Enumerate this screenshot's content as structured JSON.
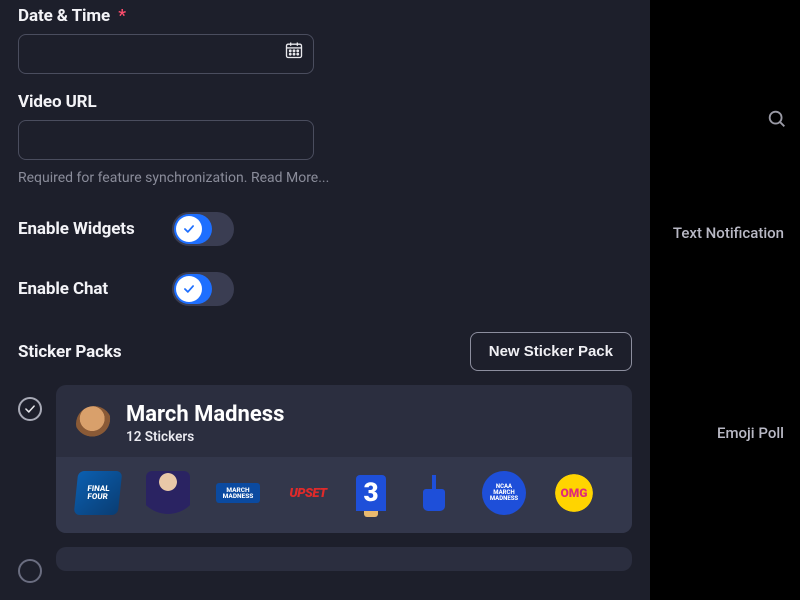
{
  "fields": {
    "datetime": {
      "label": "Date & Time",
      "required_mark": "*",
      "value": ""
    },
    "video_url": {
      "label": "Video URL",
      "value": "",
      "helper": "Required for feature synchronization.",
      "helper_link": "Read More..."
    }
  },
  "toggles": {
    "widgets": {
      "label": "Enable Widgets",
      "on": true
    },
    "chat": {
      "label": "Enable Chat",
      "on": true
    }
  },
  "sticker_section": {
    "label": "Sticker Packs",
    "new_button": "New Sticker Pack",
    "packs": [
      {
        "selected": true,
        "name": "March Madness",
        "count_label": "12 Stickers",
        "stickers": [
          {
            "name": "final-four",
            "text": "FINAL\nFOUR"
          },
          {
            "name": "player-yell",
            "text": ""
          },
          {
            "name": "march-madness-logo",
            "text": "MARCH\nMADNESS"
          },
          {
            "name": "upset",
            "text": "UPSET"
          },
          {
            "name": "foam-three",
            "text": "3"
          },
          {
            "name": "foam-finger",
            "text": ""
          },
          {
            "name": "ncaa-badge",
            "text": "NCAA\nMARCH\nMADNESS"
          },
          {
            "name": "omg",
            "text": "OMG"
          }
        ]
      },
      {
        "selected": false
      }
    ]
  },
  "background": {
    "side_labels": [
      "Text Notification",
      "Emoji Poll"
    ]
  }
}
